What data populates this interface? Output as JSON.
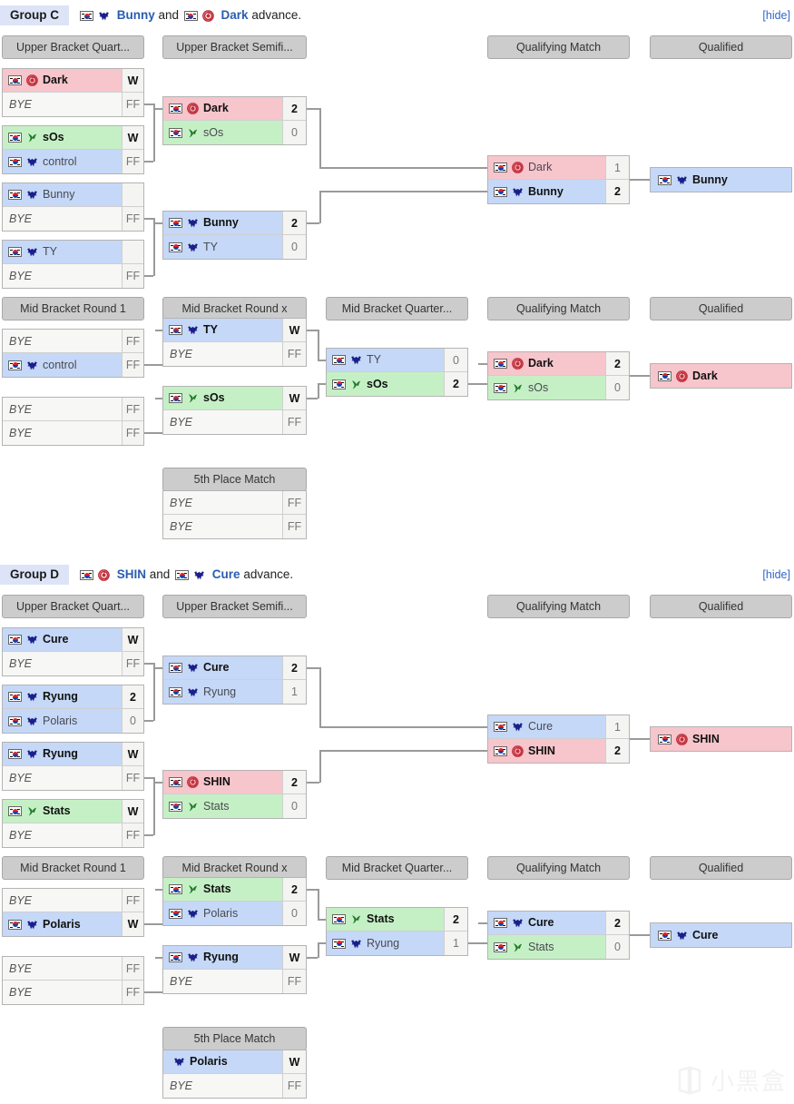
{
  "page": {
    "watermark": "小黑盒"
  },
  "colors": {
    "terran": "#c5d8f7",
    "zerg": "#c5f0c5",
    "protoss_red": "#f7c5cc",
    "neutral": "#f7f7f5",
    "header_pill": "#cccccc",
    "group_tag_bg": "#dde4f7",
    "link": "#2a5db0",
    "hide_link": "#3366cc"
  },
  "groups": [
    {
      "id": "group-c",
      "label": "Group C",
      "advance_prefix": "",
      "advance_p1": "Bunny",
      "advance_joiner": "and",
      "advance_p2": "Dark",
      "advance_suffix": "advance.",
      "hide_label": "[hide]",
      "rounds": {
        "ub_quarter": "Upper Bracket Quart...",
        "ub_semi": "Upper Bracket Semifi...",
        "qualifying": "Qualifying Match",
        "qualified": "Qualified",
        "mid_r1": "Mid Bracket Round 1",
        "mid_rx": "Mid Bracket Round x",
        "mid_quarter": "Mid Bracket Quarter...",
        "fifth": "5th Place Match"
      },
      "ub_quarterfinals": [
        {
          "top": {
            "name": "Dark",
            "race": "zerg-red",
            "score": "W",
            "winner": true,
            "flag": true
          },
          "bottom": {
            "name": "BYE",
            "race": "none",
            "score": "FF",
            "winner": false,
            "flag": false,
            "bye": true
          }
        },
        {
          "top": {
            "name": "sOs",
            "race": "zerg",
            "score": "W",
            "winner": true,
            "flag": true
          },
          "bottom": {
            "name": "control",
            "race": "terran",
            "score": "FF",
            "winner": false,
            "flag": true
          }
        },
        {
          "top": {
            "name": "Bunny",
            "race": "terran",
            "score": "",
            "winner": false,
            "flag": true
          },
          "bottom": {
            "name": "BYE",
            "race": "none",
            "score": "FF",
            "winner": false,
            "flag": false,
            "bye": true
          }
        },
        {
          "top": {
            "name": "TY",
            "race": "terran",
            "score": "",
            "winner": false,
            "flag": true
          },
          "bottom": {
            "name": "BYE",
            "race": "none",
            "score": "FF",
            "winner": false,
            "flag": false,
            "bye": true
          }
        }
      ],
      "ub_semifinals": [
        {
          "top": {
            "name": "Dark",
            "race": "zerg-red",
            "score": "2",
            "winner": true,
            "flag": true
          },
          "bottom": {
            "name": "sOs",
            "race": "zerg",
            "score": "0",
            "winner": false,
            "flag": true
          }
        },
        {
          "top": {
            "name": "Bunny",
            "race": "terran",
            "score": "2",
            "winner": true,
            "flag": true
          },
          "bottom": {
            "name": "TY",
            "race": "terran",
            "score": "0",
            "winner": false,
            "flag": true
          }
        }
      ],
      "ub_qualifying": {
        "top": {
          "name": "Dark",
          "race": "zerg-red",
          "score": "1",
          "winner": false,
          "flag": true
        },
        "bottom": {
          "name": "Bunny",
          "race": "terran",
          "score": "2",
          "winner": true,
          "flag": true
        }
      },
      "ub_qualified": {
        "name": "Bunny",
        "race": "terran",
        "flag": true
      },
      "mid_round1": [
        {
          "top": {
            "name": "BYE",
            "race": "none",
            "score": "FF",
            "winner": false,
            "flag": false,
            "bye": true
          },
          "bottom": {
            "name": "control",
            "race": "terran",
            "score": "FF",
            "winner": false,
            "flag": true
          }
        },
        {
          "top": {
            "name": "BYE",
            "race": "none",
            "score": "FF",
            "winner": false,
            "flag": false,
            "bye": true
          },
          "bottom": {
            "name": "BYE",
            "race": "none",
            "score": "FF",
            "winner": false,
            "flag": false,
            "bye": true
          }
        }
      ],
      "mid_roundx": [
        {
          "top": {
            "name": "TY",
            "race": "terran",
            "score": "W",
            "winner": true,
            "flag": true
          },
          "bottom": {
            "name": "BYE",
            "race": "none",
            "score": "FF",
            "winner": false,
            "flag": false,
            "bye": true
          }
        },
        {
          "top": {
            "name": "sOs",
            "race": "zerg",
            "score": "W",
            "winner": true,
            "flag": true
          },
          "bottom": {
            "name": "BYE",
            "race": "none",
            "score": "FF",
            "winner": false,
            "flag": false,
            "bye": true
          }
        }
      ],
      "mid_quarter": {
        "top": {
          "name": "TY",
          "race": "terran",
          "score": "0",
          "winner": false,
          "flag": true
        },
        "bottom": {
          "name": "sOs",
          "race": "zerg",
          "score": "2",
          "winner": true,
          "flag": true
        }
      },
      "mid_qualifying": {
        "top": {
          "name": "Dark",
          "race": "zerg-red",
          "score": "2",
          "winner": true,
          "flag": true
        },
        "bottom": {
          "name": "sOs",
          "race": "zerg",
          "score": "0",
          "winner": false,
          "flag": true
        }
      },
      "mid_qualified": {
        "name": "Dark",
        "race": "zerg-red",
        "flag": true
      },
      "fifth_place": {
        "top": {
          "name": "BYE",
          "race": "none",
          "score": "FF",
          "winner": false,
          "flag": false,
          "bye": true
        },
        "bottom": {
          "name": "BYE",
          "race": "none",
          "score": "FF",
          "winner": false,
          "flag": false,
          "bye": true
        }
      }
    },
    {
      "id": "group-d",
      "label": "Group D",
      "advance_prefix": "",
      "advance_p1": "SHIN",
      "advance_joiner": "and",
      "advance_p2": "Cure",
      "advance_suffix": "advance.",
      "hide_label": "[hide]",
      "rounds": {
        "ub_quarter": "Upper Bracket Quart...",
        "ub_semi": "Upper Bracket Semifi...",
        "qualifying": "Qualifying Match",
        "qualified": "Qualified",
        "mid_r1": "Mid Bracket Round 1",
        "mid_rx": "Mid Bracket Round x",
        "mid_quarter": "Mid Bracket Quarter...",
        "fifth": "5th Place Match"
      },
      "ub_quarterfinals": [
        {
          "top": {
            "name": "Cure",
            "race": "terran",
            "score": "W",
            "winner": true,
            "flag": true
          },
          "bottom": {
            "name": "BYE",
            "race": "none",
            "score": "FF",
            "winner": false,
            "flag": false,
            "bye": true
          }
        },
        {
          "top": {
            "name": "Ryung",
            "race": "terran",
            "score": "2",
            "winner": true,
            "flag": true
          },
          "bottom": {
            "name": "Polaris",
            "race": "terran",
            "score": "0",
            "winner": false,
            "flag": true
          }
        },
        {
          "top": {
            "name": "Ryung",
            "race": "terran",
            "score": "W",
            "winner": true,
            "flag": true
          },
          "bottom": {
            "name": "BYE",
            "race": "none",
            "score": "FF",
            "winner": false,
            "flag": false,
            "bye": true
          }
        },
        {
          "top": {
            "name": "Stats",
            "race": "zerg",
            "score": "W",
            "winner": true,
            "flag": true
          },
          "bottom": {
            "name": "BYE",
            "race": "none",
            "score": "FF",
            "winner": false,
            "flag": false,
            "bye": true
          }
        }
      ],
      "ub_semifinals": [
        {
          "top": {
            "name": "Cure",
            "race": "terran",
            "score": "2",
            "winner": true,
            "flag": true
          },
          "bottom": {
            "name": "Ryung",
            "race": "terran",
            "score": "1",
            "winner": false,
            "flag": true
          }
        },
        {
          "top": {
            "name": "SHIN",
            "race": "zerg-red",
            "score": "2",
            "winner": true,
            "flag": true
          },
          "bottom": {
            "name": "Stats",
            "race": "zerg",
            "score": "0",
            "winner": false,
            "flag": true
          }
        }
      ],
      "ub_qualifying": {
        "top": {
          "name": "Cure",
          "race": "terran",
          "score": "1",
          "winner": false,
          "flag": true
        },
        "bottom": {
          "name": "SHIN",
          "race": "zerg-red",
          "score": "2",
          "winner": true,
          "flag": true
        }
      },
      "ub_qualified": {
        "name": "SHIN",
        "race": "zerg-red",
        "flag": true
      },
      "mid_round1": [
        {
          "top": {
            "name": "BYE",
            "race": "none",
            "score": "FF",
            "winner": false,
            "flag": false,
            "bye": true
          },
          "bottom": {
            "name": "Polaris",
            "race": "terran",
            "score": "W",
            "winner": true,
            "flag": true
          }
        },
        {
          "top": {
            "name": "BYE",
            "race": "none",
            "score": "FF",
            "winner": false,
            "flag": false,
            "bye": true
          },
          "bottom": {
            "name": "BYE",
            "race": "none",
            "score": "FF",
            "winner": false,
            "flag": false,
            "bye": true
          }
        }
      ],
      "mid_roundx": [
        {
          "top": {
            "name": "Stats",
            "race": "zerg",
            "score": "2",
            "winner": true,
            "flag": true
          },
          "bottom": {
            "name": "Polaris",
            "race": "terran",
            "score": "0",
            "winner": false,
            "flag": true
          }
        },
        {
          "top": {
            "name": "Ryung",
            "race": "terran",
            "score": "W",
            "winner": true,
            "flag": true
          },
          "bottom": {
            "name": "BYE",
            "race": "none",
            "score": "FF",
            "winner": false,
            "flag": false,
            "bye": true
          }
        }
      ],
      "mid_quarter": {
        "top": {
          "name": "Stats",
          "race": "zerg",
          "score": "2",
          "winner": true,
          "flag": true
        },
        "bottom": {
          "name": "Ryung",
          "race": "terran",
          "score": "1",
          "winner": false,
          "flag": true
        }
      },
      "mid_qualifying": {
        "top": {
          "name": "Cure",
          "race": "terran",
          "score": "2",
          "winner": true,
          "flag": true
        },
        "bottom": {
          "name": "Stats",
          "race": "zerg",
          "score": "0",
          "winner": false,
          "flag": true
        }
      },
      "mid_qualified": {
        "name": "Cure",
        "race": "terran",
        "flag": true
      },
      "fifth_place": {
        "top": {
          "name": "Polaris",
          "race": "terran",
          "score": "W",
          "winner": true,
          "flag": false
        },
        "bottom": {
          "name": "BYE",
          "race": "none",
          "score": "FF",
          "winner": false,
          "flag": false,
          "bye": true
        }
      }
    }
  ]
}
